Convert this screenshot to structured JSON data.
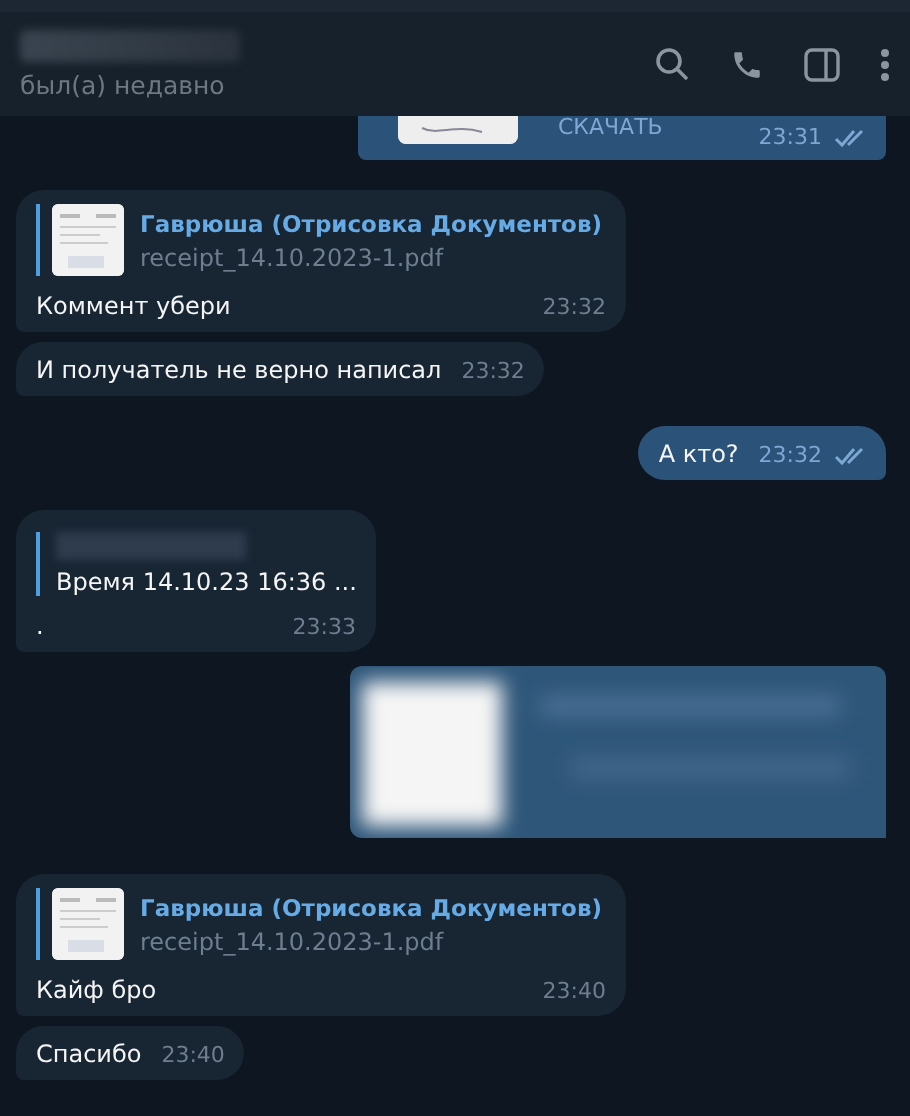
{
  "header": {
    "status": "был(а) недавно"
  },
  "messages": [
    {
      "kind": "download",
      "out": true,
      "action": "СКАЧАТЬ",
      "time": "23:31",
      "read": true
    },
    {
      "kind": "file_reply",
      "out": false,
      "reply_name": "Гаврюша (Отрисовка Документов)",
      "reply_file": "receipt_14.10.2023-1.pdf",
      "text": "Коммент убери",
      "time": "23:32"
    },
    {
      "kind": "text",
      "out": false,
      "text": "И получатель не верно написал",
      "time": "23:32"
    },
    {
      "kind": "text",
      "out": true,
      "text": "А кто?",
      "time": "23:32",
      "read": true
    },
    {
      "kind": "quote",
      "out": false,
      "quote": "Время 14.10.23 16:36  ...",
      "text": ".",
      "time": "23:33"
    },
    {
      "kind": "picture",
      "out": true
    },
    {
      "kind": "file_reply",
      "out": false,
      "reply_name": "Гаврюша (Отрисовка Документов)",
      "reply_file": "receipt_14.10.2023-1.pdf",
      "text": "Кайф бро",
      "time": "23:40"
    },
    {
      "kind": "text",
      "out": false,
      "text": "Спасибо",
      "time": "23:40"
    }
  ]
}
